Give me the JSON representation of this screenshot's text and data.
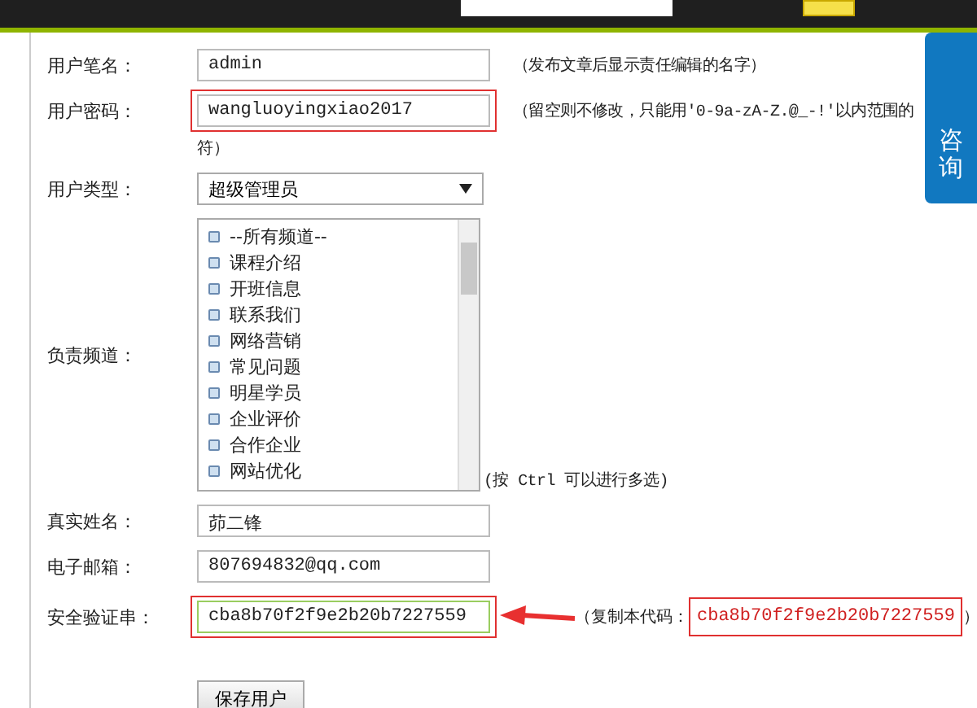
{
  "side_tab": {
    "label": "咨询"
  },
  "fields": [
    {
      "kind": "text",
      "label": "用户笔名：",
      "value": "admin",
      "hint": "（发布文章后显示责任编辑的名字）",
      "highlighted": false
    },
    {
      "kind": "text",
      "label": "用户密码：",
      "value": "wangluoyingxiao2017",
      "hint": "（留空则不修改，只能用'0-9a-zA-Z.@_-!'以内范围的",
      "hint_continued": "符）",
      "highlighted": true
    },
    {
      "kind": "select",
      "label": "用户类型：",
      "value": "超级管理员"
    },
    {
      "kind": "listbox",
      "label": "负责频道：",
      "options": [
        "--所有频道--",
        "课程介绍",
        "开班信息",
        "联系我们",
        "网络营销",
        "常见问题",
        "明星学员",
        "企业评价",
        "合作企业",
        "网站优化"
      ],
      "hint": "(按 Ctrl 可以进行多选)"
    },
    {
      "kind": "text",
      "label": "真实姓名：",
      "value": "茆二锋",
      "highlighted": false
    },
    {
      "kind": "text",
      "label": "电子邮箱：",
      "value": "807694832@qq.com",
      "highlighted": false
    },
    {
      "kind": "code",
      "label": "安全验证串：",
      "value": "cba8b70f2f9e2b20b7227559",
      "copy_prefix": "（复制本代码：",
      "code": "cba8b70f2f9e2b20b7227559",
      "copy_suffix": "）",
      "highlighted": true
    }
  ],
  "save_button": {
    "label": "保存用户"
  }
}
